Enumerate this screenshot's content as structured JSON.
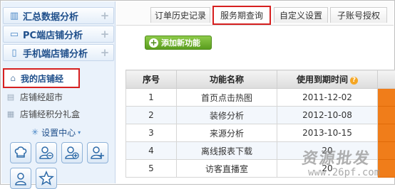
{
  "sidebar": {
    "groups": [
      {
        "icon": "bar-chart-icon",
        "label": "汇总数据分析",
        "toggle": "+"
      },
      {
        "icon": "monitor-icon",
        "label": "PC端店铺分析",
        "toggle": "+"
      },
      {
        "icon": "mobile-icon",
        "label": "手机端店铺分析",
        "toggle": "+"
      }
    ],
    "my_shop": {
      "icon": "store-icon",
      "label": "我的店铺经"
    },
    "sub_items": [
      {
        "icon": "shopping-cart-icon",
        "label": "店铺经超市"
      },
      {
        "icon": "gift-icon",
        "label": "店铺经积分礼盒"
      }
    ],
    "settings": {
      "icon": "gear-icon",
      "label": "设置中心",
      "caret": "▾"
    },
    "tool_buttons": [
      "chef-hat-icon",
      "user-remove-icon",
      "user-add-icon",
      "user-search-icon",
      "user-lock-icon",
      "star-icon"
    ]
  },
  "tabs": [
    {
      "label": "订单历史记录",
      "active": false
    },
    {
      "label": "服务期查询",
      "active": true
    },
    {
      "label": "自定义设置",
      "active": false
    },
    {
      "label": "子账号授权",
      "active": false
    }
  ],
  "add_button": {
    "icon": "plus-icon",
    "label": "添加新功能"
  },
  "table": {
    "headers": [
      "序号",
      "功能名称",
      "使用到期时间"
    ],
    "help_icon": "question-icon",
    "rows": [
      {
        "no": "1",
        "name": "首页点击热图",
        "expiry": "2011-12-02"
      },
      {
        "no": "2",
        "name": "装修分析",
        "expiry": "2012-10-08"
      },
      {
        "no": "3",
        "name": "来源分析",
        "expiry": "2013-10-15"
      },
      {
        "no": "4",
        "name": "离线报表下载",
        "expiry": "20"
      },
      {
        "no": "5",
        "name": "访客直播室",
        "expiry": "20"
      }
    ]
  },
  "watermark": {
    "cn": "资源批发",
    "url": "www.26pf.com"
  },
  "colors": {
    "accent_orange": "#f07d1a",
    "highlight_red": "#d61f1f",
    "sidebar_blue": "#1f4f8b",
    "add_green": "#5a9d1e"
  }
}
